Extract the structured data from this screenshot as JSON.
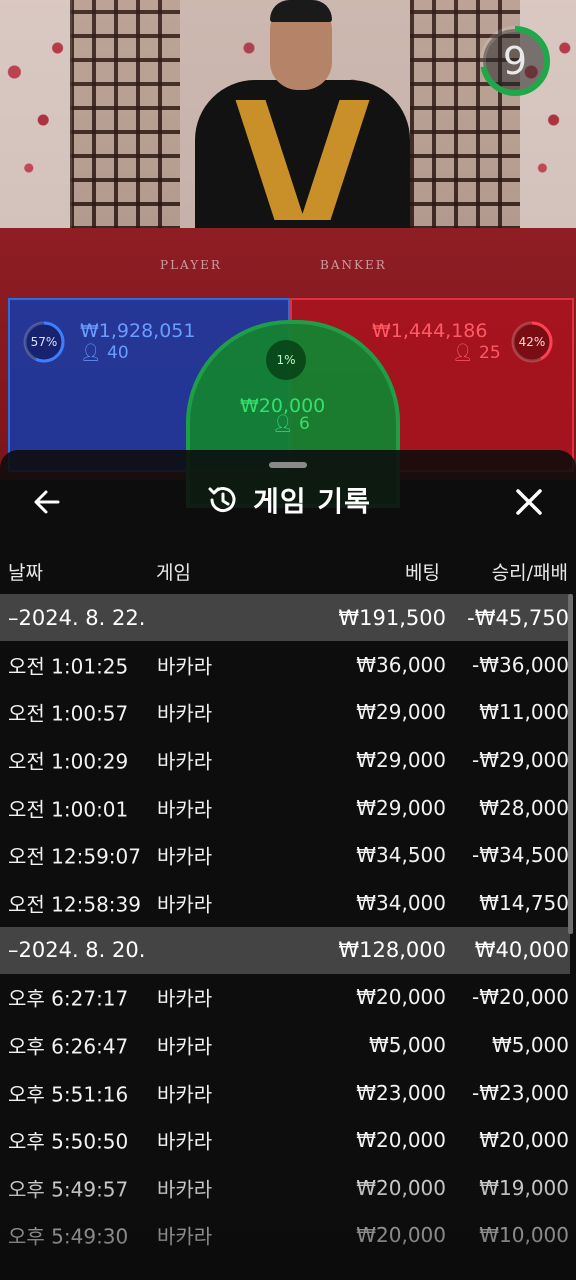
{
  "game_scene": {
    "table_labels": {
      "player": "PLAYER",
      "banker": "BANKER"
    },
    "timer": {
      "value": "9",
      "remaining_fraction": 0.72,
      "color": "#1fa84a"
    },
    "player": {
      "percent": "57%",
      "amount": "₩1,928,051",
      "count": "40",
      "fraction": 0.57,
      "color": "#2f6be0"
    },
    "banker": {
      "percent": "42%",
      "amount": "₩1,444,186",
      "count": "25",
      "fraction": 0.42,
      "color": "#e03040"
    },
    "tie": {
      "percent": "1%",
      "amount": "₩20,000",
      "count": "6",
      "color": "#1f9e48"
    },
    "person_icon": "person-icon"
  },
  "history": {
    "title": "게임 기록",
    "icons": {
      "back": "arrow-left-icon",
      "history": "history-clock-icon",
      "close": "close-icon"
    },
    "columns": {
      "date": "날짜",
      "game": "게임",
      "bet": "베팅",
      "result": "승리/패배"
    },
    "groups": [
      {
        "date": "–2024. 8. 22.",
        "bet": "₩191,500",
        "result": "-₩45,750",
        "rows": [
          {
            "time": "오전 1:01:25",
            "game": "바카라",
            "bet": "₩36,000",
            "result": "-₩36,000"
          },
          {
            "time": "오전 1:00:57",
            "game": "바카라",
            "bet": "₩29,000",
            "result": "₩11,000"
          },
          {
            "time": "오전 1:00:29",
            "game": "바카라",
            "bet": "₩29,000",
            "result": "-₩29,000"
          },
          {
            "time": "오전 1:00:01",
            "game": "바카라",
            "bet": "₩29,000",
            "result": "₩28,000"
          },
          {
            "time": "오전 12:59:07",
            "game": "바카라",
            "bet": "₩34,500",
            "result": "-₩34,500"
          },
          {
            "time": "오전 12:58:39",
            "game": "바카라",
            "bet": "₩34,000",
            "result": "₩14,750"
          }
        ]
      },
      {
        "date": "–2024. 8. 20.",
        "bet": "₩128,000",
        "result": "₩40,000",
        "rows": [
          {
            "time": "오후 6:27:17",
            "game": "바카라",
            "bet": "₩20,000",
            "result": "-₩20,000"
          },
          {
            "time": "오후 6:26:47",
            "game": "바카라",
            "bet": "₩5,000",
            "result": "₩5,000"
          },
          {
            "time": "오후 5:51:16",
            "game": "바카라",
            "bet": "₩23,000",
            "result": "-₩23,000"
          },
          {
            "time": "오후 5:50:50",
            "game": "바카라",
            "bet": "₩20,000",
            "result": "₩20,000"
          },
          {
            "time": "오후 5:49:57",
            "game": "바카라",
            "bet": "₩20,000",
            "result": "₩19,000"
          },
          {
            "time": "오후 5:49:30",
            "game": "바카라",
            "bet": "₩20,000",
            "result": "₩10,000"
          }
        ]
      }
    ]
  }
}
